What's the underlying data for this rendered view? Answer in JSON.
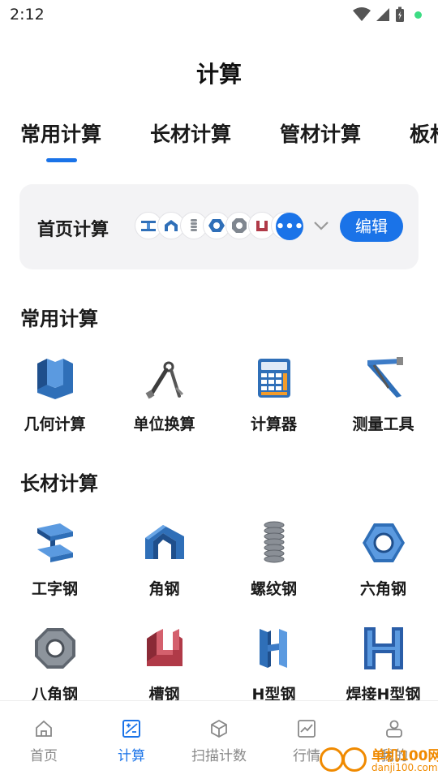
{
  "status_bar": {
    "time": "2:12"
  },
  "page": {
    "title": "计算"
  },
  "tabs": [
    {
      "label": "常用计算",
      "active": true
    },
    {
      "label": "长材计算",
      "active": false
    },
    {
      "label": "管材计算",
      "active": false
    },
    {
      "label": "板材计算",
      "active": false
    }
  ],
  "home_calc": {
    "label": "首页计算",
    "icons": [
      "i-beam-icon",
      "angle-steel-icon",
      "threaded-steel-icon",
      "hex-steel-icon",
      "octagon-steel-icon",
      "channel-steel-icon",
      "h-beam-icon"
    ],
    "edit_label": "编辑"
  },
  "sections": [
    {
      "title": "常用计算",
      "items": [
        {
          "label": "几何计算",
          "icon": "geometry-icon"
        },
        {
          "label": "单位换算",
          "icon": "compass-icon"
        },
        {
          "label": "计算器",
          "icon": "calculator-icon"
        },
        {
          "label": "测量工具",
          "icon": "measure-tool-icon"
        }
      ]
    },
    {
      "title": "长材计算",
      "items": [
        {
          "label": "工字钢",
          "icon": "i-beam-icon"
        },
        {
          "label": "角钢",
          "icon": "angle-steel-icon"
        },
        {
          "label": "螺纹钢",
          "icon": "threaded-steel-icon"
        },
        {
          "label": "六角钢",
          "icon": "hex-steel-icon"
        },
        {
          "label": "八角钢",
          "icon": "octagon-steel-icon"
        },
        {
          "label": "槽钢",
          "icon": "channel-steel-icon"
        },
        {
          "label": "H型钢",
          "icon": "h-beam-icon"
        },
        {
          "label": "焊接H型钢",
          "icon": "welded-h-beam-icon"
        }
      ]
    }
  ],
  "bottom_nav": [
    {
      "label": "首页",
      "icon": "home-icon",
      "active": false
    },
    {
      "label": "计算",
      "icon": "calculate-icon",
      "active": true
    },
    {
      "label": "扫描计数",
      "icon": "scan-count-icon",
      "active": false
    },
    {
      "label": "行情",
      "icon": "market-chart-icon",
      "active": false
    },
    {
      "label": "我的",
      "icon": "profile-icon",
      "active": false
    }
  ],
  "watermark": {
    "brand": "单机100网",
    "url": "danji100.com"
  },
  "colors": {
    "accent": "#1a73e8",
    "card_bg": "#f3f3f5",
    "steel_blue": "#2f6fb8",
    "steel_red": "#b03a48"
  }
}
